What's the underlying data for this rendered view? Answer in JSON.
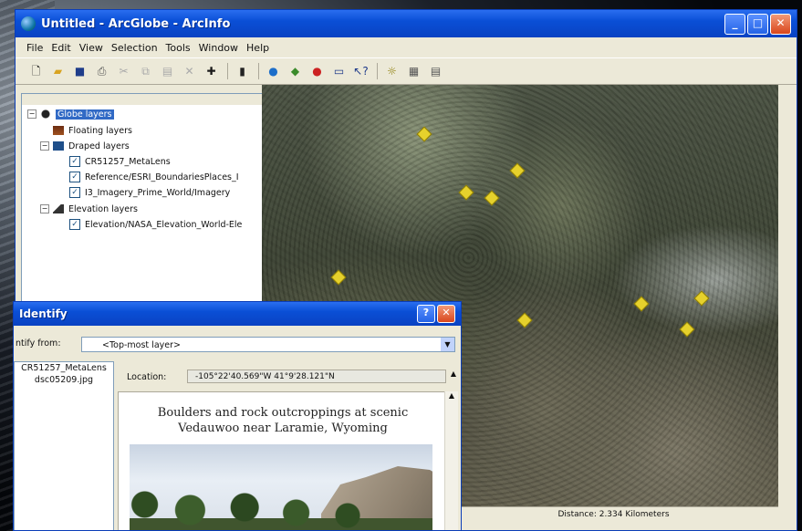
{
  "window": {
    "title": "Untitled - ArcGlobe - ArcInfo",
    "controls": {
      "minimize": "_",
      "maximize": "□",
      "close": "✕"
    }
  },
  "menubar": [
    "File",
    "Edit",
    "View",
    "Selection",
    "Tools",
    "Window",
    "Help"
  ],
  "toolbar": {
    "icons": [
      "new-document-icon",
      "open-folder-icon",
      "save-icon",
      "print-icon",
      "cut-icon",
      "copy-icon",
      "paste-icon",
      "delete-icon",
      "add-data-icon",
      "toc-icon",
      "globe-icon",
      "arctoolbox-icon",
      "model-builder-icon",
      "window-icon",
      "whats-this-icon",
      "layer-props-icon",
      "table-icon",
      "grid-icon"
    ]
  },
  "toc": {
    "root": "Globe layers",
    "items": [
      {
        "label": "Floating layers",
        "level": 1
      },
      {
        "label": "Draped layers",
        "level": 1
      },
      {
        "label": "CR51257_MetaLens",
        "level": 2
      },
      {
        "label": "Reference/ESRI_BoundariesPlaces_I",
        "level": 2
      },
      {
        "label": "I3_Imagery_Prime_World/Imagery",
        "level": 2
      },
      {
        "label": "Elevation layers",
        "level": 1
      },
      {
        "label": "Elevation/NASA_Elevation_World-Ele",
        "level": 2
      }
    ]
  },
  "globe_view": {
    "status": "Distance: 2.334 Kilometers"
  },
  "identify": {
    "title": "Identify",
    "identify_from_label": "ntify from:",
    "layer": "<Top-most layer>",
    "features": [
      "CR51257_MetaLens",
      "dsc05209.jpg"
    ],
    "location_label": "Location:",
    "location_value": "-105°22'40.569\"W  41°9'28.121\"N",
    "popup_title": "Boulders and rock outcroppings at scenic Vedauwoo near Laramie, Wyoming"
  }
}
